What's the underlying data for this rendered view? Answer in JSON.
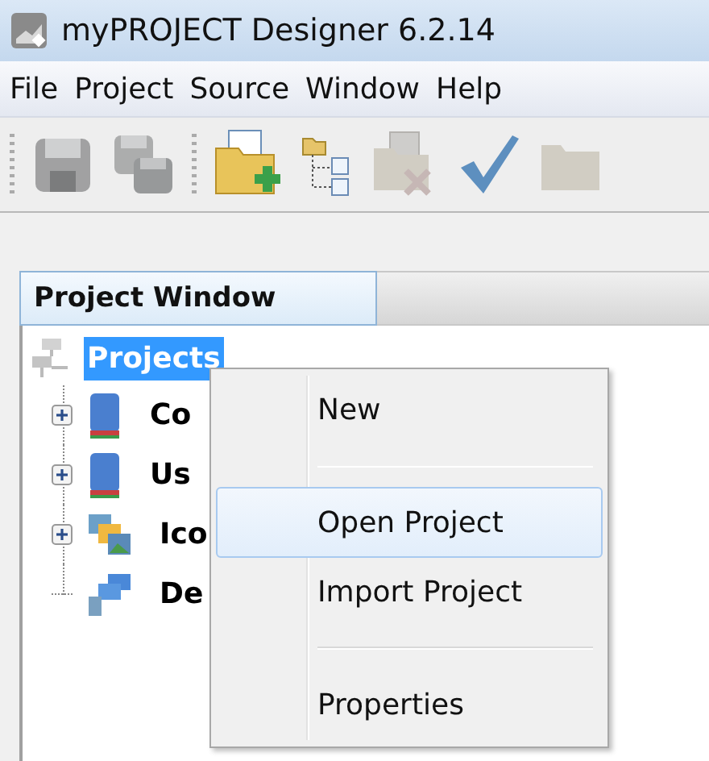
{
  "window": {
    "title": "myPROJECT Designer 6.2.14"
  },
  "menu_bar": [
    "File",
    "Project",
    "Source",
    "Window",
    "Help"
  ],
  "toolbar": [
    {
      "kind": "save",
      "disabled": true
    },
    {
      "kind": "save-all",
      "disabled": true
    },
    {
      "kind": "separator"
    },
    {
      "kind": "new-project",
      "disabled": false
    },
    {
      "kind": "tree",
      "disabled": false
    },
    {
      "kind": "close-project",
      "disabled": true
    },
    {
      "kind": "check",
      "disabled": false
    },
    {
      "kind": "folder",
      "disabled": true
    }
  ],
  "tabs": [
    {
      "label": "Project Window",
      "selected": true
    }
  ],
  "tree": {
    "label": "Projects",
    "selected": true,
    "children": [
      {
        "label": "Co",
        "kind": "book",
        "expanded": false
      },
      {
        "label": "Us",
        "kind": "book",
        "expanded": false
      },
      {
        "label": "Ico",
        "kind": "images",
        "expanded": false
      },
      {
        "label": "De",
        "kind": "devices"
      }
    ]
  },
  "context_menu": [
    {
      "kind": "item",
      "label": "New",
      "selected": false
    },
    {
      "kind": "separator"
    },
    {
      "kind": "item",
      "label": "Open Project",
      "selected": true
    },
    {
      "kind": "item",
      "label": "Import Project",
      "selected": false
    },
    {
      "kind": "separator"
    },
    {
      "kind": "item",
      "label": "Properties",
      "selected": false
    }
  ]
}
